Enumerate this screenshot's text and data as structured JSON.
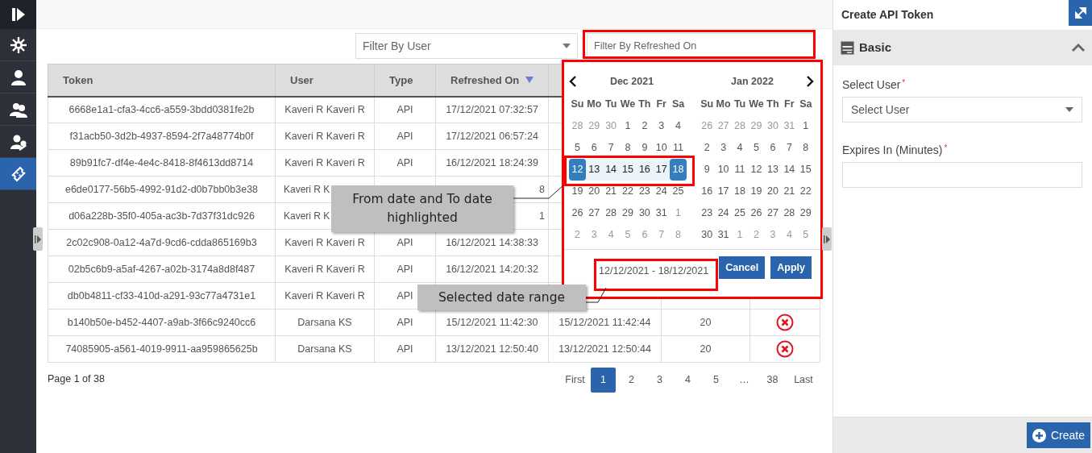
{
  "sidebar": {
    "items": [
      {
        "selected": false
      },
      {
        "selected": false
      },
      {
        "selected": false
      },
      {
        "selected": false
      },
      {
        "selected": true
      }
    ]
  },
  "filters": {
    "user": {
      "placeholder": "Filter By User"
    },
    "refreshed_on": {
      "placeholder": "Filter By Refreshed On"
    }
  },
  "table": {
    "columns": [
      {
        "label": "Token",
        "sorted": false
      },
      {
        "label": "User",
        "sorted": false
      },
      {
        "label": "Type",
        "sorted": false
      },
      {
        "label": "Refreshed On",
        "sorted": true
      }
    ],
    "rows": [
      {
        "token": "6668e1a1-cfa3-4cc6-a559-3bdd0381fe2b",
        "user": "Kaveri R Kaveri R",
        "type": "API",
        "refreshed_on": "17/12/2021 07:32:57",
        "deletable": false
      },
      {
        "token": "f31acb50-3d2b-4937-8594-2f7a48774b0f",
        "user": "Kaveri R Kaveri R",
        "type": "API",
        "refreshed_on": "17/12/2021 06:57:24",
        "deletable": false
      },
      {
        "token": "89b91fc7-df4e-4e4c-8418-8f4613dd8714",
        "user": "Kaveri R Kaveri R",
        "type": "API",
        "refreshed_on": "16/12/2021 18:24:39",
        "deletable": false
      },
      {
        "token": "e6de0177-56b5-4992-91d2-d0b7bb0b3e38",
        "user": "Kaveri R K",
        "refreshed_on": "8",
        "deletable": false
      },
      {
        "token": "d06a228b-35f0-405a-ac3b-7d37f31dc926",
        "user": "Kaveri R K",
        "refreshed_on": "1",
        "deletable": false
      },
      {
        "token": "2c02c908-0a12-4a7d-9cd6-cdda865169b3",
        "user": "Kaveri R Kaveri R",
        "type": "API",
        "refreshed_on": "16/12/2021 14:38:33",
        "deletable": false
      },
      {
        "token": "02b5c6b9-a5af-4267-a02b-3174a8d8f487",
        "user": "Kaveri R Kaveri R",
        "type": "API",
        "refreshed_on": "16/12/2021 14:20:32",
        "deletable": false
      },
      {
        "token": "db0b4811-cf33-410d-a291-93c77a4731e1",
        "user": "Kaveri R Kaveri R",
        "type": "API",
        "deletable": false
      },
      {
        "token": "b140b50e-b452-4407-a9ab-3f66c9240cc6",
        "user": "Darsana KS",
        "type": "API",
        "refreshed_on": "15/12/2021 11:42:30",
        "column_5": "15/12/2021 11:42:44",
        "column_6": "20",
        "deletable": true
      },
      {
        "token": "74085905-a561-4019-9911-aa959865625b",
        "user": "Darsana KS",
        "type": "API",
        "refreshed_on": "13/12/2021 12:50:40",
        "column_5": "13/12/2021 12:50:44",
        "column_6": "20",
        "deletable": true
      }
    ]
  },
  "pagination": {
    "summary": "Page 1 of 38",
    "pages": [
      {
        "label": "First",
        "selected": false
      },
      {
        "label": "1",
        "selected": true
      },
      {
        "label": "2",
        "selected": false
      },
      {
        "label": "3",
        "selected": false
      },
      {
        "label": "4",
        "selected": false
      },
      {
        "label": "5",
        "selected": false
      },
      {
        "label": "…",
        "selected": false
      },
      {
        "label": "38",
        "selected": false
      },
      {
        "label": "Last",
        "selected": false
      }
    ]
  },
  "date_picker": {
    "months": [
      {
        "title": "Dec 2021",
        "weekdays": [
          "Su",
          "Mo",
          "Tu",
          "We",
          "Th",
          "Fr",
          "Sa"
        ],
        "weeks": [
          [
            {
              "day": "28",
              "kind": "muted"
            },
            {
              "day": "29",
              "kind": "muted"
            },
            {
              "day": "30",
              "kind": "muted"
            },
            {
              "day": "1",
              "kind": "normal"
            },
            {
              "day": "2",
              "kind": "normal"
            },
            {
              "day": "3",
              "kind": "normal"
            },
            {
              "day": "4",
              "kind": "normal"
            }
          ],
          [
            {
              "day": "5",
              "kind": "normal"
            },
            {
              "day": "6",
              "kind": "normal"
            },
            {
              "day": "7",
              "kind": "normal"
            },
            {
              "day": "8",
              "kind": "normal"
            },
            {
              "day": "9",
              "kind": "normal"
            },
            {
              "day": "10",
              "kind": "normal"
            },
            {
              "day": "11",
              "kind": "normal"
            }
          ],
          [
            {
              "day": "12",
              "kind": "range_end"
            },
            {
              "day": "13",
              "kind": "in_range"
            },
            {
              "day": "14",
              "kind": "in_range"
            },
            {
              "day": "15",
              "kind": "in_range"
            },
            {
              "day": "16",
              "kind": "in_range"
            },
            {
              "day": "17",
              "kind": "in_range"
            },
            {
              "day": "18",
              "kind": "range_end"
            }
          ],
          [
            {
              "day": "19",
              "kind": "normal"
            },
            {
              "day": "20",
              "kind": "normal"
            },
            {
              "day": "21",
              "kind": "normal"
            },
            {
              "day": "22",
              "kind": "normal"
            },
            {
              "day": "23",
              "kind": "normal"
            },
            {
              "day": "24",
              "kind": "normal"
            },
            {
              "day": "25",
              "kind": "normal"
            }
          ],
          [
            {
              "day": "26",
              "kind": "normal"
            },
            {
              "day": "27",
              "kind": "normal"
            },
            {
              "day": "28",
              "kind": "normal"
            },
            {
              "day": "29",
              "kind": "normal"
            },
            {
              "day": "30",
              "kind": "normal"
            },
            {
              "day": "31",
              "kind": "normal"
            },
            {
              "day": "1",
              "kind": "muted"
            }
          ],
          [
            {
              "day": "2",
              "kind": "muted"
            },
            {
              "day": "3",
              "kind": "muted"
            },
            {
              "day": "4",
              "kind": "muted"
            },
            {
              "day": "5",
              "kind": "muted"
            },
            {
              "day": "6",
              "kind": "muted"
            },
            {
              "day": "7",
              "kind": "muted"
            },
            {
              "day": "8",
              "kind": "muted"
            }
          ]
        ]
      },
      {
        "title": "Jan 2022",
        "weekdays": [
          "Su",
          "Mo",
          "Tu",
          "We",
          "Th",
          "Fr",
          "Sa"
        ],
        "weeks": [
          [
            {
              "day": "26",
              "kind": "muted"
            },
            {
              "day": "27",
              "kind": "muted"
            },
            {
              "day": "28",
              "kind": "muted"
            },
            {
              "day": "29",
              "kind": "muted"
            },
            {
              "day": "30",
              "kind": "muted"
            },
            {
              "day": "31",
              "kind": "muted"
            },
            {
              "day": "1",
              "kind": "normal"
            }
          ],
          [
            {
              "day": "2",
              "kind": "normal"
            },
            {
              "day": "3",
              "kind": "normal"
            },
            {
              "day": "4",
              "kind": "normal"
            },
            {
              "day": "5",
              "kind": "normal"
            },
            {
              "day": "6",
              "kind": "normal"
            },
            {
              "day": "7",
              "kind": "normal"
            },
            {
              "day": "8",
              "kind": "normal"
            }
          ],
          [
            {
              "day": "9",
              "kind": "normal"
            },
            {
              "day": "10",
              "kind": "normal"
            },
            {
              "day": "11",
              "kind": "normal"
            },
            {
              "day": "12",
              "kind": "normal"
            },
            {
              "day": "13",
              "kind": "normal"
            },
            {
              "day": "14",
              "kind": "normal"
            },
            {
              "day": "15",
              "kind": "normal"
            }
          ],
          [
            {
              "day": "16",
              "kind": "normal"
            },
            {
              "day": "17",
              "kind": "normal"
            },
            {
              "day": "18",
              "kind": "normal"
            },
            {
              "day": "19",
              "kind": "normal"
            },
            {
              "day": "20",
              "kind": "normal"
            },
            {
              "day": "21",
              "kind": "normal"
            },
            {
              "day": "22",
              "kind": "normal"
            }
          ],
          [
            {
              "day": "23",
              "kind": "normal"
            },
            {
              "day": "24",
              "kind": "normal"
            },
            {
              "day": "25",
              "kind": "normal"
            },
            {
              "day": "26",
              "kind": "normal"
            },
            {
              "day": "27",
              "kind": "normal"
            },
            {
              "day": "28",
              "kind": "normal"
            },
            {
              "day": "29",
              "kind": "normal"
            }
          ],
          [
            {
              "day": "30",
              "kind": "normal"
            },
            {
              "day": "31",
              "kind": "normal"
            },
            {
              "day": "1",
              "kind": "muted"
            },
            {
              "day": "2",
              "kind": "muted"
            },
            {
              "day": "3",
              "kind": "muted"
            },
            {
              "day": "4",
              "kind": "muted"
            },
            {
              "day": "5",
              "kind": "muted"
            }
          ]
        ]
      }
    ],
    "range_text": "12/12/2021 - 18/12/2021",
    "buttons": [
      "Cancel",
      "Apply"
    ]
  },
  "annotations": [
    {
      "text": "From date and To date highlighted"
    },
    {
      "text": "Selected date range"
    }
  ],
  "panel": {
    "title": "Create API Token",
    "section": {
      "title": "Basic",
      "expanded": true
    },
    "fields": [
      {
        "label": "Select User",
        "required_mark": "*",
        "kind": "select",
        "placeholder": "Select User"
      },
      {
        "label": "Expires In (Minutes)",
        "required_mark": "*",
        "kind": "input"
      }
    ],
    "button": "Create"
  }
}
